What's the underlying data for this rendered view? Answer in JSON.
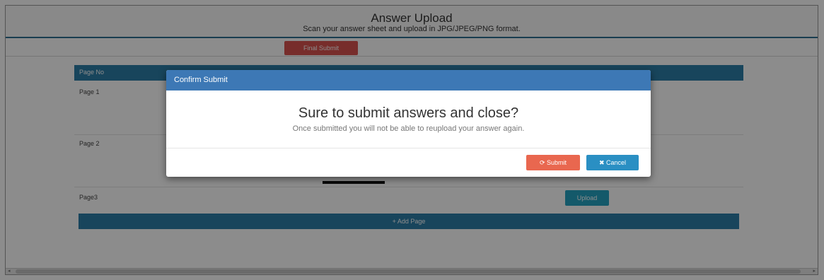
{
  "header": {
    "title": "Answer Upload",
    "subtitle": "Scan your answer sheet and upload in JPG/JPEG/PNG format."
  },
  "toolbar": {
    "final_submit_label": "Final Submit"
  },
  "table": {
    "column_header": "Page No",
    "rows": [
      {
        "label": "Page 1"
      },
      {
        "label": "Page 2"
      },
      {
        "label": "Page3",
        "upload_label": "Upload"
      }
    ]
  },
  "add_page_label": "+ Add Page",
  "modal": {
    "title": "Confirm Submit",
    "question": "Sure to submit answers and close?",
    "note": "Once submitted you will not be able to reupload your answer again.",
    "submit_label": "⟳ Submit",
    "cancel_label": "✖ Cancel"
  },
  "colors": {
    "primary": "#2d7ea8",
    "danger": "#d9534f",
    "info": "#26a3c2",
    "modal_header": "#3d78b5"
  }
}
